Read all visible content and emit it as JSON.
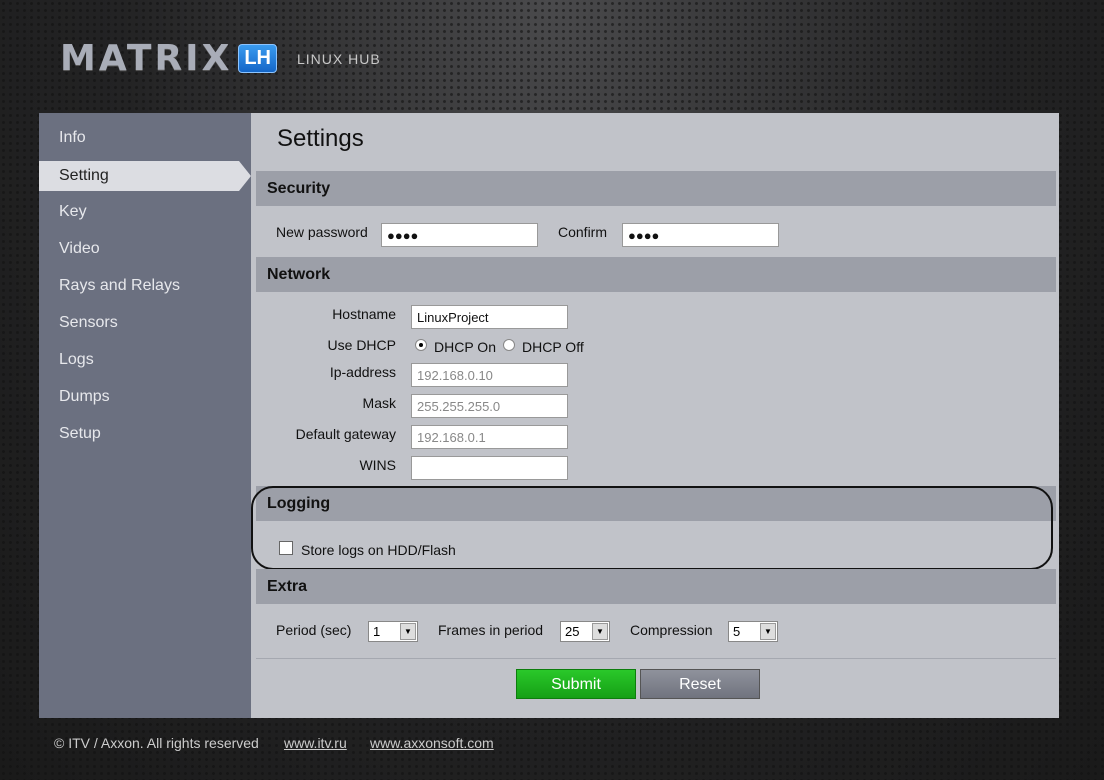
{
  "header": {
    "logo_text": "MATRIX",
    "logo_badge": "LH",
    "subtitle": "LINUX HUB"
  },
  "sidebar": {
    "items": [
      {
        "label": "Info"
      },
      {
        "label": "Setting",
        "active": true
      },
      {
        "label": "Key"
      },
      {
        "label": "Video"
      },
      {
        "label": "Rays and Relays"
      },
      {
        "label": "Sensors"
      },
      {
        "label": "Logs"
      },
      {
        "label": "Dumps"
      },
      {
        "label": "Setup"
      }
    ]
  },
  "page_title": "Settings",
  "security": {
    "title": "Security",
    "new_password_label": "New password",
    "new_password_value": "●●●●",
    "confirm_label": "Confirm",
    "confirm_value": "●●●●"
  },
  "network": {
    "title": "Network",
    "hostname_label": "Hostname",
    "hostname_value": "LinuxProject",
    "dhcp_label": "Use DHCP",
    "dhcp_on": "DHCP On",
    "dhcp_off": "DHCP Off",
    "dhcp_selected": "on",
    "ip_label": "Ip-address",
    "ip_value": "192.168.0.10",
    "mask_label": "Mask",
    "mask_value": "255.255.255.0",
    "gateway_label": "Default gateway",
    "gateway_value": "192.168.0.1",
    "wins_label": "WINS",
    "wins_value": ""
  },
  "logging": {
    "title": "Logging",
    "store_logs_label": "Store logs on HDD/Flash",
    "store_logs_checked": false
  },
  "extra": {
    "title": "Extra",
    "period_label": "Period (sec)",
    "period_value": "1",
    "frames_label": "Frames in period",
    "frames_value": "25",
    "compression_label": "Compression",
    "compression_value": "5"
  },
  "buttons": {
    "submit": "Submit",
    "reset": "Reset"
  },
  "colors": {
    "submit": "#1fb21f",
    "reset": "#7e818c"
  },
  "footer": {
    "copyright": "© ITV / Axxon. All rights reserved",
    "link1": "www.itv.ru",
    "link2": "www.axxonsoft.com"
  }
}
